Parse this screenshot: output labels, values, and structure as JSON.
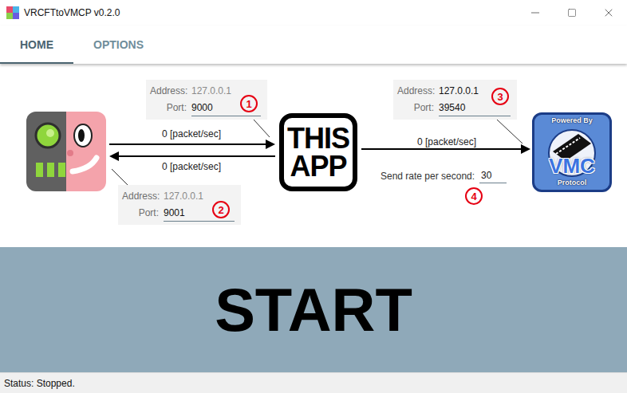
{
  "window": {
    "title": "VRCFTtoVMCP v0.2.0"
  },
  "tabs": [
    {
      "label": "HOME",
      "selected": true
    },
    {
      "label": "OPTIONS",
      "selected": false
    }
  ],
  "endpoints": [
    {
      "marker": "1",
      "address_label": "Address:",
      "address": "127.0.0.1",
      "address_disabled": true,
      "port_label": "Port:",
      "port": "9000"
    },
    {
      "marker": "2",
      "address_label": "Address:",
      "address": "127.0.0.1",
      "address_disabled": true,
      "port_label": "Port:",
      "port": "9001"
    },
    {
      "marker": "3",
      "address_label": "Address:",
      "address": "127.0.0.1",
      "address_disabled": false,
      "port_label": "Port:",
      "port": "39540"
    }
  ],
  "flows": [
    {
      "rate": "0",
      "unit": "[packet/sec]"
    },
    {
      "rate": "0",
      "unit": "[packet/sec]"
    },
    {
      "rate": "0",
      "unit": "[packet/sec]"
    }
  ],
  "send_rate": {
    "label": "Send rate per second:",
    "value": "30",
    "marker": "4"
  },
  "app_logo": {
    "lines": [
      "THIS",
      "APP"
    ]
  },
  "vmc_logo": {
    "top": "Powered By",
    "main": "VMC",
    "bottom": "Protocol"
  },
  "start_button": {
    "label": "START"
  },
  "status_bar": {
    "text": "Status: Stopped."
  }
}
